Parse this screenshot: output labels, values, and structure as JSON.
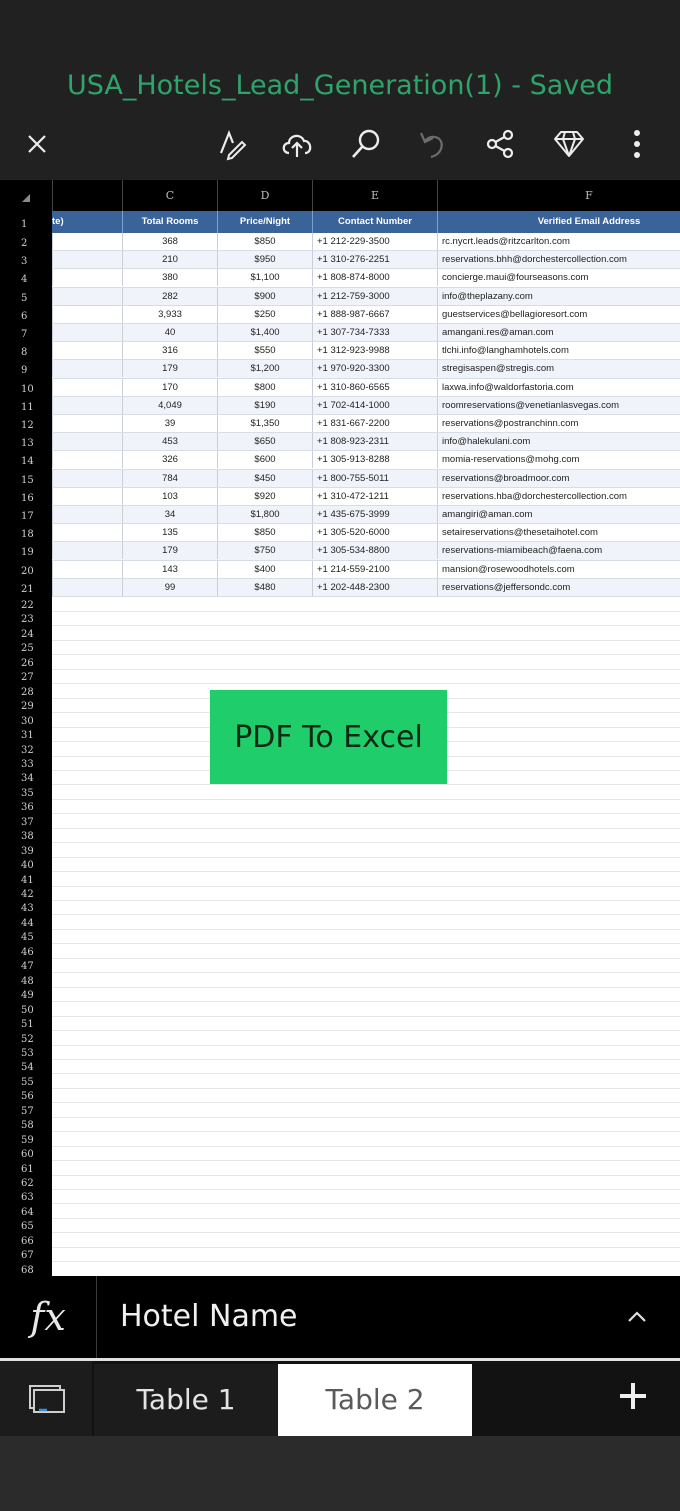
{
  "title": "USA_Hotels_Lead_Generation(1) - Saved",
  "toolbar": {
    "icons": [
      "close-icon",
      "pen-format-icon",
      "cloud-upload-icon",
      "search-icon",
      "undo-icon",
      "share-icon",
      "diamond-icon",
      "more-icon"
    ]
  },
  "columns": [
    "C",
    "D",
    "E",
    "F"
  ],
  "header_row": {
    "b_partial": "te)",
    "c": "Total Rooms",
    "d": "Price/Night",
    "e": "Contact Number",
    "f": "Verified Email Address"
  },
  "rows": [
    {
      "c": "368",
      "d": "$850",
      "e": "+1 212-229-3500",
      "f": "rc.nycrt.leads@ritzcarlton.com"
    },
    {
      "c": "210",
      "d": "$950",
      "e": "+1 310-276-2251",
      "f": "reservations.bhh@dorchestercollection.com"
    },
    {
      "c": "380",
      "d": "$1,100",
      "e": "+1 808-874-8000",
      "f": "concierge.maui@fourseasons.com"
    },
    {
      "c": "282",
      "d": "$900",
      "e": "+1 212-759-3000",
      "f": "info@theplazany.com"
    },
    {
      "c": "3,933",
      "d": "$250",
      "e": "+1 888-987-6667",
      "f": "guestservices@bellagioresort.com"
    },
    {
      "c": "40",
      "d": "$1,400",
      "e": "+1 307-734-7333",
      "f": "amangani.res@aman.com"
    },
    {
      "c": "316",
      "d": "$550",
      "e": "+1 312-923-9988",
      "f": "tlchi.info@langhamhotels.com"
    },
    {
      "c": "179",
      "d": "$1,200",
      "e": "+1 970-920-3300",
      "f": "stregisaspen@stregis.com"
    },
    {
      "c": "170",
      "d": "$800",
      "e": "+1 310-860-6565",
      "f": "laxwa.info@waldorfastoria.com"
    },
    {
      "c": "4,049",
      "d": "$190",
      "e": "+1 702-414-1000",
      "f": "roomreservations@venetianlasvegas.com"
    },
    {
      "c": "39",
      "d": "$1,350",
      "e": "+1 831-667-2200",
      "f": "reservations@postranchinn.com"
    },
    {
      "c": "453",
      "d": "$650",
      "e": "+1 808-923-2311",
      "f": "info@halekulani.com"
    },
    {
      "c": "326",
      "d": "$600",
      "e": "+1 305-913-8288",
      "f": "momia-reservations@mohg.com"
    },
    {
      "c": "784",
      "d": "$450",
      "e": "+1 800-755-5011",
      "f": "reservations@broadmoor.com"
    },
    {
      "c": "103",
      "d": "$920",
      "e": "+1 310-472-1211",
      "f": "reservations.hba@dorchestercollection.com"
    },
    {
      "c": "34",
      "d": "$1,800",
      "e": "+1 435-675-3999",
      "f": "amangiri@aman.com"
    },
    {
      "c": "135",
      "d": "$850",
      "e": "+1 305-520-6000",
      "f": "setaireservations@thesetaihotel.com"
    },
    {
      "c": "179",
      "d": "$750",
      "e": "+1 305-534-8800",
      "f": "reservations-miamibeach@faena.com"
    },
    {
      "c": "143",
      "d": "$400",
      "e": "+1 214-559-2100",
      "f": "mansion@rosewoodhotels.com"
    },
    {
      "c": "99",
      "d": "$480",
      "e": "+1 202-448-2300",
      "f": "reservations@jeffersondc.com"
    }
  ],
  "row_numbers": [
    "1",
    "2",
    "3",
    "4",
    "5",
    "6",
    "7",
    "8",
    "9",
    "10",
    "11",
    "12",
    "13",
    "14",
    "15",
    "16",
    "17",
    "18",
    "19",
    "20",
    "21",
    "22",
    "23",
    "24",
    "25",
    "26",
    "27",
    "28",
    "29",
    "30",
    "31",
    "32",
    "33",
    "34",
    "35",
    "36",
    "37",
    "38",
    "39",
    "40",
    "41",
    "42",
    "43",
    "44",
    "45",
    "46",
    "47",
    "48",
    "49",
    "50",
    "51",
    "52",
    "53",
    "54",
    "55",
    "56",
    "57",
    "58",
    "59",
    "60",
    "61",
    "62",
    "63",
    "64",
    "65",
    "66",
    "67",
    "68"
  ],
  "overlay_button": "PDF To Excel",
  "formula_bar": {
    "fx_label": "fx",
    "value": "Hotel Name"
  },
  "tabs": [
    {
      "label": "Table 1",
      "active": false
    },
    {
      "label": "Table 2",
      "active": true
    }
  ],
  "colors": {
    "title": "#2ea46a",
    "header_fill": "#3a6399",
    "overlay_button": "#1fce6a"
  }
}
